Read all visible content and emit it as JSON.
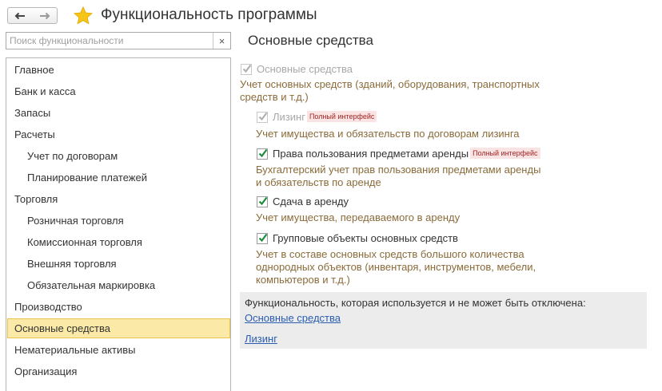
{
  "window": {
    "title": "Функциональность программы",
    "icons": {
      "back": "arrow-left-icon",
      "forward": "arrow-right-icon",
      "favorite": "star-icon"
    },
    "accent_star": "#f5c518"
  },
  "search": {
    "placeholder": "Поиск функциональности",
    "value": "",
    "clear_label": "×"
  },
  "sidebar": {
    "items": [
      {
        "label": "Главное",
        "level": 0
      },
      {
        "label": "Банк и касса",
        "level": 0
      },
      {
        "label": "Запасы",
        "level": 0
      },
      {
        "label": "Расчеты",
        "level": 0
      },
      {
        "label": "Учет по договорам",
        "level": 1
      },
      {
        "label": "Планирование платежей",
        "level": 1
      },
      {
        "label": "Торговля",
        "level": 0
      },
      {
        "label": "Розничная торговля",
        "level": 1
      },
      {
        "label": "Комиссионная торговля",
        "level": 1
      },
      {
        "label": "Внешняя торговля",
        "level": 1
      },
      {
        "label": "Обязательная маркировка",
        "level": 1
      },
      {
        "label": "Производство",
        "level": 0
      },
      {
        "label": "Основные средства",
        "level": 0,
        "selected": true
      },
      {
        "label": "Нематериальные активы",
        "level": 0
      },
      {
        "label": "Организация",
        "level": 0
      }
    ],
    "selected_color": "#fbe9a7"
  },
  "main": {
    "title": "Основные средства",
    "options": [
      {
        "label": "Основные средства",
        "checked": true,
        "enabled": false,
        "badge": "",
        "description": [
          "Учет основных средств (зданий, оборудования, транспортных",
          "средств и т.д.)"
        ]
      },
      {
        "label": "Лизинг",
        "checked": true,
        "enabled": false,
        "badge": "Полный интерфейс",
        "description": [
          "Учет имущества и обязательств  по договорам лизинга"
        ]
      },
      {
        "label": "Права пользования предметами аренды",
        "checked": true,
        "enabled": true,
        "badge": "Полный интерфейс",
        "description": [
          "Бухгалтерский учет прав пользования предметами аренды",
          "и обязательств по аренде"
        ]
      },
      {
        "label": "Сдача в аренду",
        "checked": true,
        "enabled": true,
        "badge": "",
        "description": [
          "Учет имущества, передаваемого в аренду"
        ]
      },
      {
        "label": "Групповые объекты основных средств",
        "checked": true,
        "enabled": true,
        "badge": "",
        "description": [
          "Учет в составе основных средств большого количества",
          "однородных объектов (инвентаря, инструментов, мебели,",
          "компьютеров и т.д.)"
        ]
      }
    ],
    "info": {
      "caption": "Функциональность, которая используется и не может быть отключена:",
      "links": [
        "Основные средства",
        "Лизинг"
      ]
    },
    "colors": {
      "check_enabled": "#1a8c3a",
      "check_disabled": "#b0b0b0",
      "description": "#8a6b3a",
      "link": "#2a5db0",
      "badge_bg": "#fae3e3",
      "badge_text": "#a32626"
    }
  }
}
